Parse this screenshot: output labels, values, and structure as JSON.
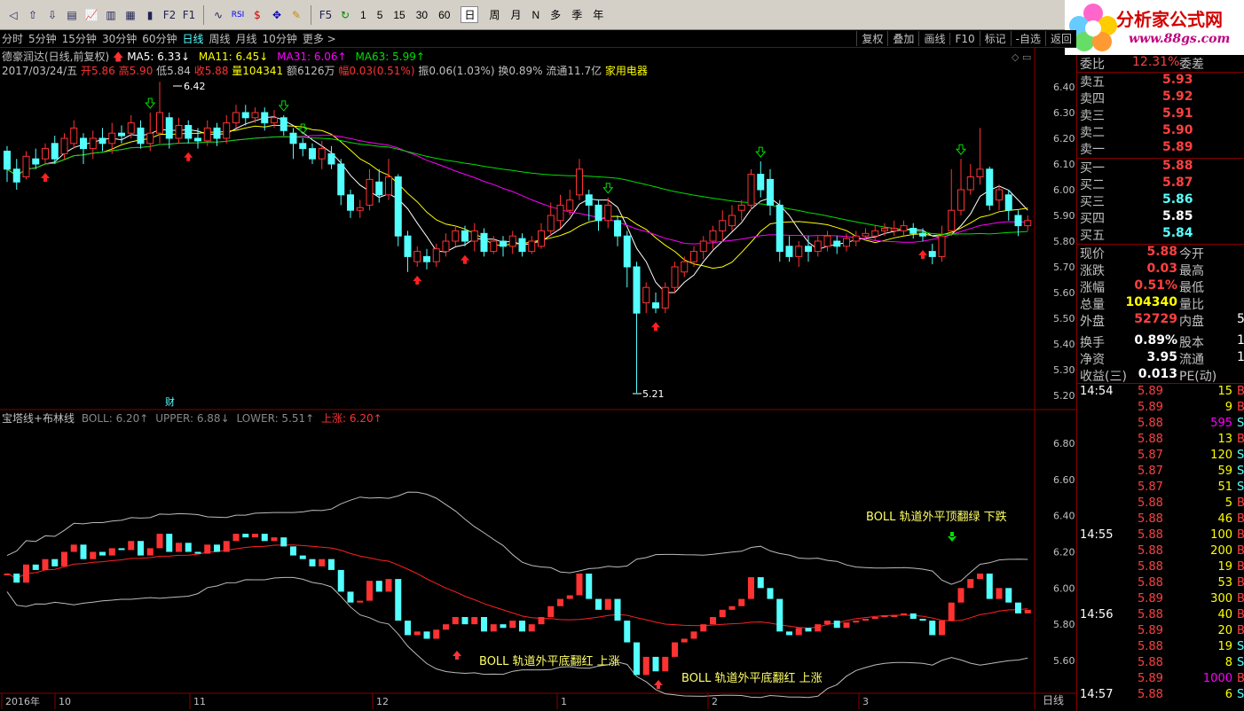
{
  "toolbar": {
    "periods": [
      "1",
      "5",
      "15",
      "30",
      "60"
    ],
    "ranges": [
      "日",
      "周",
      "月",
      "N",
      "多",
      "季",
      "年"
    ]
  },
  "brand": {
    "name": "分析家公式网",
    "url": "www.88gs.com"
  },
  "period_bar": {
    "items": [
      "分时",
      "5分钟",
      "15分钟",
      "30分钟",
      "60分钟",
      "日线",
      "周线",
      "月线",
      "10分钟",
      "更多 >"
    ],
    "active": "日线",
    "right_buttons": [
      "复权",
      "叠加",
      "画线",
      "F10",
      "标记",
      "-自选",
      "返回"
    ]
  },
  "stock": {
    "title": "德豪润达(日线,前复权)",
    "ma5": "MA5: 6.33↓",
    "ma11": "MA11: 6.45↓",
    "ma31": "MA31: 6.06↑",
    "ma63": "MA63: 5.99↑",
    "date": "2017/03/24/五",
    "open": "开5.86",
    "high": "高5.90",
    "low": "低5.84",
    "close": "收5.88",
    "volume": "量104341",
    "amount": "额6126万",
    "change": "幅0.03(0.51%)",
    "amplitude": "振0.06(1.03%)",
    "turnover": "换0.89%",
    "float": "流通11.7亿",
    "sector": "家用电器"
  },
  "colors": {
    "up": "#ff3232",
    "down": "#54ffff",
    "ma5": "#ffffff",
    "ma11": "#ffff00",
    "ma31": "#ff00ff",
    "ma63": "#00e000"
  },
  "price_axis": [
    "6.40",
    "6.30",
    "6.20",
    "6.10",
    "6.00",
    "5.90",
    "5.80",
    "5.70",
    "5.60",
    "5.50",
    "5.40",
    "5.30",
    "5.20"
  ],
  "annotations": {
    "high_mark": "6.42",
    "low_mark": "5.21",
    "finance_mark": "财"
  },
  "boll": {
    "title": "宝塔线+布林线",
    "boll": "BOLL: 6.20↑",
    "upper": "UPPER: 6.88↓",
    "lower": "LOWER: 5.51↑",
    "up_signal": "上涨: 6.20↑",
    "axis": [
      "6.80",
      "6.60",
      "6.40",
      "6.20",
      "6.00",
      "5.80",
      "5.60"
    ],
    "note_top": "BOLL 轨道外平顶翻绿 下跌",
    "note_bottom1": "BOLL 轨道外平底翻红 上涨",
    "note_bottom2": "BOLL 轨道外平底翻红 上涨"
  },
  "time_axis": {
    "labels": [
      "2016年",
      "10",
      "11",
      "12",
      "1",
      "2",
      "3"
    ],
    "corner": "日线"
  },
  "quote": {
    "wb_label": "委比",
    "wb_value": "12.31%",
    "wc_label": "委差",
    "asks": [
      {
        "label": "卖五",
        "price": "5.93"
      },
      {
        "label": "卖四",
        "price": "5.92"
      },
      {
        "label": "卖三",
        "price": "5.91"
      },
      {
        "label": "卖二",
        "price": "5.90"
      },
      {
        "label": "卖一",
        "price": "5.89"
      }
    ],
    "bids": [
      {
        "label": "买一",
        "price": "5.88"
      },
      {
        "label": "买二",
        "price": "5.87"
      },
      {
        "label": "买三",
        "price": "5.86"
      },
      {
        "label": "买四",
        "price": "5.85"
      },
      {
        "label": "买五",
        "price": "5.84"
      }
    ],
    "stats": [
      {
        "l": "现价",
        "v": "5.88",
        "r": "今开",
        "c": "#ff4040"
      },
      {
        "l": "涨跌",
        "v": "0.03",
        "r": "最高",
        "c": "#ff4040"
      },
      {
        "l": "涨幅",
        "v": "0.51%",
        "r": "最低",
        "c": "#ff4040"
      },
      {
        "l": "总量",
        "v": "104340",
        "r": "量比",
        "c": "#ffff00"
      },
      {
        "l": "外盘",
        "v": "52729",
        "r": "内盘",
        "c": "#ff4040"
      },
      {
        "l": "换手",
        "v": "0.89%",
        "r": "股本",
        "c": "#ffffff"
      },
      {
        "l": "净资",
        "v": "3.95",
        "r": "流通",
        "c": "#ffffff"
      },
      {
        "l": "收益(三)",
        "v": "0.013",
        "r": "PE(动)",
        "c": "#ffffff"
      }
    ],
    "stat_tail": [
      "",
      "",
      "",
      "",
      "5",
      "1",
      "1",
      ""
    ],
    "ticks": [
      {
        "t": "14:54",
        "p": "5.89",
        "v": "15",
        "d": "B"
      },
      {
        "t": "",
        "p": "5.89",
        "v": "9",
        "d": "B"
      },
      {
        "t": "",
        "p": "5.88",
        "v": "595",
        "d": "S"
      },
      {
        "t": "",
        "p": "5.88",
        "v": "13",
        "d": "B"
      },
      {
        "t": "",
        "p": "5.87",
        "v": "120",
        "d": "S"
      },
      {
        "t": "",
        "p": "5.87",
        "v": "59",
        "d": "S"
      },
      {
        "t": "",
        "p": "5.87",
        "v": "51",
        "d": "S"
      },
      {
        "t": "",
        "p": "5.88",
        "v": "5",
        "d": "B"
      },
      {
        "t": "",
        "p": "5.88",
        "v": "46",
        "d": "B"
      },
      {
        "t": "14:55",
        "p": "5.88",
        "v": "100",
        "d": "B"
      },
      {
        "t": "",
        "p": "5.88",
        "v": "200",
        "d": "B"
      },
      {
        "t": "",
        "p": "5.88",
        "v": "19",
        "d": "B"
      },
      {
        "t": "",
        "p": "5.88",
        "v": "53",
        "d": "B"
      },
      {
        "t": "",
        "p": "5.89",
        "v": "300",
        "d": "B"
      },
      {
        "t": "14:56",
        "p": "5.88",
        "v": "40",
        "d": "B"
      },
      {
        "t": "",
        "p": "5.89",
        "v": "20",
        "d": "B"
      },
      {
        "t": "",
        "p": "5.88",
        "v": "19",
        "d": "S"
      },
      {
        "t": "",
        "p": "5.88",
        "v": "8",
        "d": "S"
      },
      {
        "t": "",
        "p": "5.89",
        "v": "1000",
        "d": "B"
      },
      {
        "t": "14:57",
        "p": "5.88",
        "v": "6",
        "d": "S"
      }
    ]
  },
  "chart_data": {
    "type": "candlestick",
    "ylim": [
      5.18,
      6.45
    ],
    "candles": [
      [
        6.15,
        6.08,
        6.17,
        6.03
      ],
      [
        6.08,
        6.03,
        6.12,
        6.0
      ],
      [
        6.05,
        6.13,
        6.15,
        6.04
      ],
      [
        6.12,
        6.1,
        6.16,
        6.08
      ],
      [
        6.12,
        6.16,
        6.18,
        6.1
      ],
      [
        6.18,
        6.12,
        6.21,
        6.1
      ],
      [
        6.14,
        6.2,
        6.22,
        6.12
      ],
      [
        6.18,
        6.24,
        6.27,
        6.16
      ],
      [
        6.2,
        6.16,
        6.22,
        6.1
      ],
      [
        6.16,
        6.2,
        6.23,
        6.12
      ],
      [
        6.2,
        6.18,
        6.24,
        6.15
      ],
      [
        6.18,
        6.22,
        6.26,
        6.14
      ],
      [
        6.22,
        6.21,
        6.25,
        6.18
      ],
      [
        6.22,
        6.26,
        6.29,
        6.2
      ],
      [
        6.24,
        6.18,
        6.27,
        6.16
      ],
      [
        6.18,
        6.22,
        6.3,
        6.15
      ],
      [
        6.22,
        6.3,
        6.42,
        6.18
      ],
      [
        6.28,
        6.2,
        6.3,
        6.16
      ],
      [
        6.2,
        6.25,
        6.28,
        6.18
      ],
      [
        6.25,
        6.2,
        6.27,
        6.18
      ],
      [
        6.2,
        6.19,
        6.24,
        6.16
      ],
      [
        6.19,
        6.24,
        6.27,
        6.17
      ],
      [
        6.24,
        6.2,
        6.26,
        6.17
      ],
      [
        6.2,
        6.26,
        6.29,
        6.18
      ],
      [
        6.26,
        6.3,
        6.33,
        6.24
      ],
      [
        6.3,
        6.28,
        6.33,
        6.25
      ],
      [
        6.28,
        6.3,
        6.32,
        6.26
      ],
      [
        6.3,
        6.26,
        6.32,
        6.23
      ],
      [
        6.26,
        6.28,
        6.31,
        6.24
      ],
      [
        6.28,
        6.23,
        6.29,
        6.21
      ],
      [
        6.22,
        6.18,
        6.24,
        6.12
      ],
      [
        6.18,
        6.16,
        6.2,
        6.13
      ],
      [
        6.16,
        6.12,
        6.18,
        6.1
      ],
      [
        6.12,
        6.16,
        6.19,
        6.08
      ],
      [
        6.14,
        6.1,
        6.17,
        6.08
      ],
      [
        6.1,
        5.98,
        6.12,
        5.94
      ],
      [
        5.98,
        5.92,
        6.0,
        5.89
      ],
      [
        5.92,
        5.93,
        5.96,
        5.89
      ],
      [
        5.94,
        6.04,
        6.08,
        5.92
      ],
      [
        6.03,
        5.98,
        6.08,
        5.95
      ],
      [
        5.98,
        6.05,
        6.12,
        5.96
      ],
      [
        6.05,
        5.82,
        6.06,
        5.78
      ],
      [
        5.82,
        5.74,
        5.84,
        5.68
      ],
      [
        5.72,
        5.76,
        5.78,
        5.7
      ],
      [
        5.74,
        5.72,
        5.77,
        5.69
      ],
      [
        5.72,
        5.77,
        5.79,
        5.7
      ],
      [
        5.76,
        5.8,
        5.83,
        5.74
      ],
      [
        5.8,
        5.84,
        5.86,
        5.78
      ],
      [
        5.84,
        5.8,
        5.86,
        5.78
      ],
      [
        5.8,
        5.84,
        5.87,
        5.76
      ],
      [
        5.83,
        5.76,
        5.85,
        5.74
      ],
      [
        5.76,
        5.8,
        5.82,
        5.75
      ],
      [
        5.8,
        5.78,
        5.82,
        5.74
      ],
      [
        5.78,
        5.82,
        5.84,
        5.75
      ],
      [
        5.81,
        5.76,
        5.83,
        5.74
      ],
      [
        5.76,
        5.8,
        5.82,
        5.75
      ],
      [
        5.78,
        5.84,
        5.87,
        5.77
      ],
      [
        5.84,
        5.9,
        5.95,
        5.82
      ],
      [
        5.88,
        5.94,
        5.98,
        5.85
      ],
      [
        5.92,
        5.96,
        6.0,
        5.9
      ],
      [
        5.98,
        6.08,
        6.12,
        5.96
      ],
      [
        5.98,
        5.94,
        6.0,
        5.88
      ],
      [
        5.94,
        5.88,
        5.96,
        5.84
      ],
      [
        5.88,
        5.94,
        5.97,
        5.85
      ],
      [
        5.88,
        5.82,
        5.9,
        5.78
      ],
      [
        5.82,
        5.7,
        5.84,
        5.62
      ],
      [
        5.7,
        5.52,
        5.72,
        5.21
      ],
      [
        5.56,
        5.62,
        5.64,
        5.52
      ],
      [
        5.56,
        5.54,
        5.6,
        5.52
      ],
      [
        5.54,
        5.62,
        5.64,
        5.52
      ],
      [
        5.62,
        5.7,
        5.72,
        5.6
      ],
      [
        5.68,
        5.72,
        5.74,
        5.66
      ],
      [
        5.72,
        5.76,
        5.78,
        5.7
      ],
      [
        5.76,
        5.8,
        5.82,
        5.73
      ],
      [
        5.8,
        5.84,
        5.86,
        5.77
      ],
      [
        5.84,
        5.88,
        5.92,
        5.8
      ],
      [
        5.86,
        5.9,
        5.94,
        5.84
      ],
      [
        5.92,
        5.94,
        5.96,
        5.88
      ],
      [
        5.94,
        6.06,
        6.08,
        5.92
      ],
      [
        6.06,
        6.0,
        6.11,
        5.97
      ],
      [
        6.04,
        5.94,
        6.08,
        5.9
      ],
      [
        5.94,
        5.76,
        5.96,
        5.72
      ],
      [
        5.78,
        5.74,
        5.82,
        5.72
      ],
      [
        5.74,
        5.78,
        5.8,
        5.7
      ],
      [
        5.78,
        5.76,
        5.82,
        5.72
      ],
      [
        5.76,
        5.8,
        5.82,
        5.74
      ],
      [
        5.78,
        5.82,
        5.84,
        5.76
      ],
      [
        5.8,
        5.78,
        5.82,
        5.75
      ],
      [
        5.78,
        5.81,
        5.83,
        5.76
      ],
      [
        5.8,
        5.82,
        5.84,
        5.78
      ],
      [
        5.82,
        5.83,
        5.85,
        5.8
      ],
      [
        5.82,
        5.84,
        5.86,
        5.8
      ],
      [
        5.84,
        5.85,
        5.87,
        5.82
      ],
      [
        5.84,
        5.85,
        5.88,
        5.82
      ],
      [
        5.84,
        5.86,
        5.88,
        5.82
      ],
      [
        5.85,
        5.83,
        5.87,
        5.81
      ],
      [
        5.83,
        5.82,
        5.85,
        5.8
      ],
      [
        5.76,
        5.74,
        5.79,
        5.71
      ],
      [
        5.74,
        5.82,
        5.86,
        5.72
      ],
      [
        5.84,
        5.92,
        6.08,
        5.82
      ],
      [
        5.92,
        6.0,
        6.12,
        5.9
      ],
      [
        6.0,
        6.05,
        6.1,
        5.98
      ],
      [
        6.05,
        6.08,
        6.24,
        6.02
      ],
      [
        6.08,
        5.94,
        6.09,
        5.92
      ],
      [
        5.96,
        6.0,
        6.02,
        5.92
      ],
      [
        5.98,
        5.92,
        6.0,
        5.88
      ],
      [
        5.9,
        5.86,
        5.92,
        5.82
      ],
      [
        5.86,
        5.88,
        5.9,
        5.84
      ]
    ]
  }
}
